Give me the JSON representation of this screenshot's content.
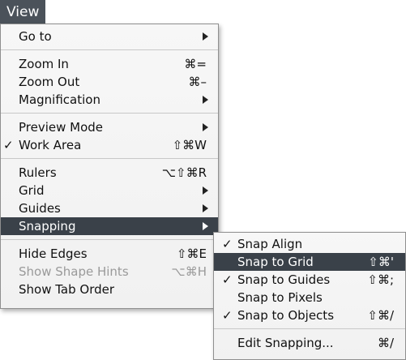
{
  "menu_title": "View",
  "main_menu": {
    "go_to": "Go to",
    "zoom_in": "Zoom In",
    "zoom_in_shortcut": "⌘=",
    "zoom_out": "Zoom Out",
    "zoom_out_shortcut": "⌘–",
    "magnification": "Magnification",
    "preview_mode": "Preview Mode",
    "work_area": "Work Area",
    "work_area_shortcut": "⇧⌘W",
    "rulers": "Rulers",
    "rulers_shortcut": "⌥⇧⌘R",
    "grid": "Grid",
    "guides": "Guides",
    "snapping": "Snapping",
    "hide_edges": "Hide Edges",
    "hide_edges_shortcut": "⇧⌘E",
    "show_shape_hints": "Show Shape Hints",
    "show_shape_hints_shortcut": "⌥⌘H",
    "show_tab_order": "Show Tab Order"
  },
  "snapping_menu": {
    "snap_align": "Snap Align",
    "snap_to_grid": "Snap to Grid",
    "snap_to_grid_shortcut": "⇧⌘'",
    "snap_to_guides": "Snap to Guides",
    "snap_to_guides_shortcut": "⇧⌘;",
    "snap_to_pixels": "Snap to Pixels",
    "snap_to_objects": "Snap to Objects",
    "snap_to_objects_shortcut": "⇧⌘/",
    "edit_snapping": "Edit Snapping...",
    "edit_snapping_shortcut": "⌘/"
  },
  "checkmark": "✓"
}
